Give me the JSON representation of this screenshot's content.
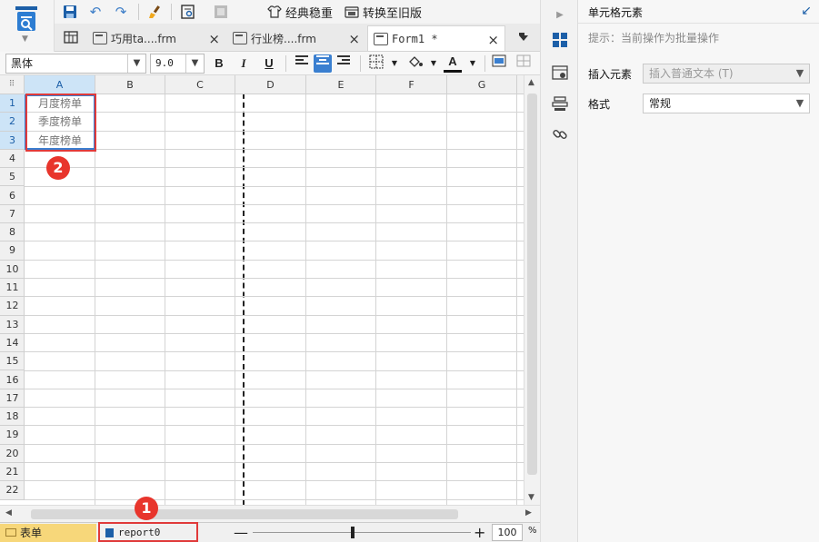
{
  "toolbar": {
    "classic_stable_label": "经典稳重",
    "convert_old_label": "转换至旧版"
  },
  "tabs": [
    {
      "label": "巧用ta....frm",
      "close": "×"
    },
    {
      "label": "行业榜....frm",
      "close": "×"
    },
    {
      "label": "Form1 *",
      "close": "×"
    }
  ],
  "format_bar": {
    "font_family": "黑体",
    "font_size": "9.0",
    "bold": "B",
    "italic": "I",
    "underline": "U",
    "font_color_label": "A"
  },
  "sheet": {
    "columns": [
      "A",
      "B",
      "C",
      "D",
      "E",
      "F",
      "G"
    ],
    "rows": [
      "1",
      "2",
      "3",
      "4",
      "5",
      "6",
      "7",
      "8",
      "9",
      "10",
      "11",
      "12",
      "13",
      "14",
      "15",
      "16",
      "17",
      "18",
      "19",
      "20",
      "21",
      "22"
    ],
    "cells": [
      {
        "col": "A",
        "row": "1",
        "text": "月度榜单"
      },
      {
        "col": "A",
        "row": "2",
        "text": "季度榜单"
      },
      {
        "col": "A",
        "row": "3",
        "text": "年度榜单"
      }
    ],
    "selected_column": "A",
    "selected_rows": [
      "1",
      "2",
      "3"
    ]
  },
  "status": {
    "sheet_tab_label": "表单",
    "report_tab_label": "report0",
    "zoom_value": "100",
    "zoom_unit": "%",
    "zoom_minus": "—",
    "zoom_plus": "+",
    "zoom_level": 100
  },
  "annotations": {
    "badge1": "1",
    "badge2": "2"
  },
  "panel": {
    "title": "单元格元素",
    "hint": "提示：当前操作为批量操作",
    "insert_label": "插入元素",
    "insert_value": "插入普通文本 (T)",
    "format_label": "格式",
    "format_value": "常规"
  },
  "colors": {
    "accent": "#1c5fa8",
    "selection": "#cde4f7",
    "annotation_red": "#e03a3a",
    "sheet_tab": "#f7d77a"
  }
}
